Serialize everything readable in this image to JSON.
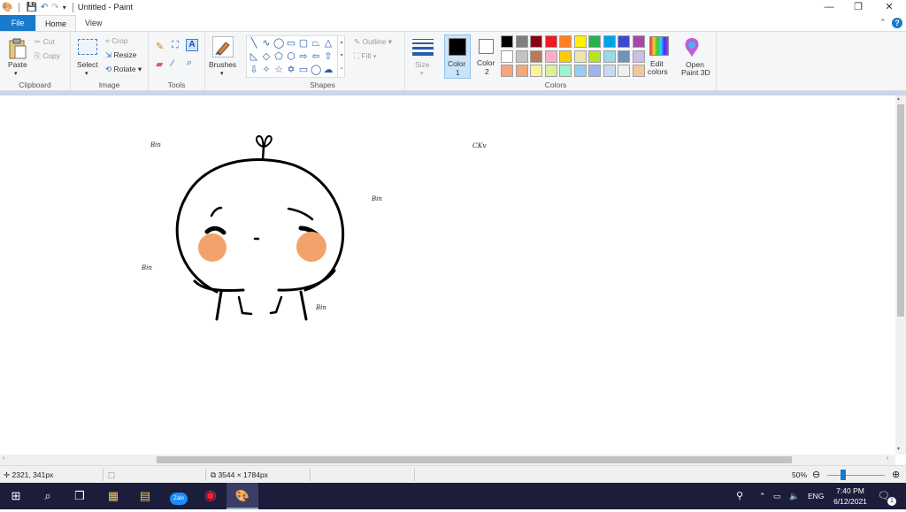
{
  "window": {
    "title": "Untitled - Paint",
    "minimize_glyph": "—",
    "restore_glyph": "❐",
    "close_glyph": "✕"
  },
  "quick_access": {
    "app_icon": "paint-palette-icon",
    "save_icon": "save-icon",
    "undo_icon": "undo-icon",
    "redo_icon": "redo-icon",
    "customize_icon": "chevron-down-icon"
  },
  "tabs": [
    {
      "label": "File"
    },
    {
      "label": "Home"
    },
    {
      "label": "View"
    }
  ],
  "ribbon": {
    "clipboard": {
      "group_label": "Clipboard",
      "paste_label": "Paste",
      "cut_label": "Cut",
      "copy_label": "Copy"
    },
    "image": {
      "group_label": "Image",
      "select_label": "Select",
      "crop_label": "Crop",
      "resize_label": "Resize",
      "rotate_label": "Rotate"
    },
    "tools": {
      "group_label": "Tools"
    },
    "brushes": {
      "label": "Brushes"
    },
    "shapes": {
      "group_label": "Shapes",
      "outline_label": "Outline",
      "fill_label": "Fill"
    },
    "size": {
      "label": "Size"
    },
    "colors": {
      "group_label": "Colors",
      "color1_label": "Color",
      "color1_num": "1",
      "color2_label": "Color",
      "color2_num": "2",
      "color1_value": "#000000",
      "color2_value": "#ffffff",
      "edit_colors_line1": "Edit",
      "edit_colors_line2": "colors",
      "paint3d_line1": "Open",
      "paint3d_line2": "Paint 3D",
      "palette_row1": [
        "#000000",
        "#7f7f7f",
        "#880015",
        "#ed1c24",
        "#ff7f27",
        "#fff200",
        "#22b14c",
        "#00a2e8",
        "#3f48cc",
        "#a349a4"
      ],
      "palette_row2": [
        "#ffffff",
        "#c3c3c3",
        "#b97a57",
        "#ffaec9",
        "#ffc90e",
        "#efe4b0",
        "#b5e61d",
        "#99d9ea",
        "#7092be",
        "#c8bfe7"
      ],
      "palette_row3": [
        "#f4a77a",
        "#f4a77a",
        "#f9f39a",
        "#d9f29a",
        "#9ef2cf",
        "#99ccf2",
        "#9fb3f2",
        "#c9d8f2",
        "#efefef",
        "#f4c79a"
      ]
    }
  },
  "canvas": {
    "signatures": [
      "Bin",
      "Bin",
      "Bin",
      "Bin"
    ],
    "ckv_text": "CKv",
    "colors": {
      "line": "#000000",
      "blush": "#f4a26b"
    }
  },
  "status": {
    "cursor_pos": "2321, 341px",
    "image_size": "3544 × 1784px",
    "zoom": "50%"
  },
  "taskbar": {
    "tray_lang": "ENG",
    "time": "7:40 PM",
    "date": "6/12/2021",
    "notif_count": "1"
  }
}
